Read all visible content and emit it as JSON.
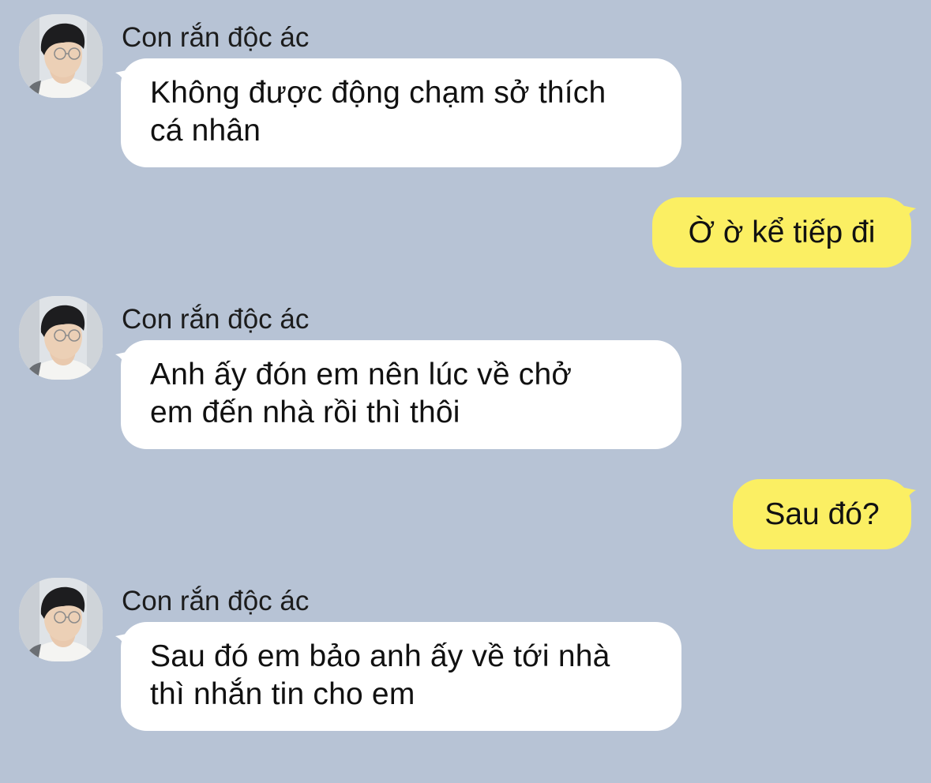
{
  "chat": {
    "messages": [
      {
        "direction": "incoming",
        "sender": "Con rắn độc ác",
        "text_line1": "Không được động chạm sở thích",
        "text_line2": "cá nhân"
      },
      {
        "direction": "outgoing",
        "text": "Ờ ờ kể tiếp đi"
      },
      {
        "direction": "incoming",
        "sender": "Con rắn độc ác",
        "text_line1": "Anh ấy đón em nên lúc về chở",
        "text_line2": "em đến nhà rồi thì thôi"
      },
      {
        "direction": "outgoing",
        "text": "Sau đó?"
      },
      {
        "direction": "incoming",
        "sender": "Con rắn độc ác",
        "text_line1": "Sau đó em bảo anh ấy về tới nhà",
        "text_line2": "thì nhắn tin cho em"
      }
    ]
  },
  "colors": {
    "background": "#b7c3d5",
    "incoming_bubble": "#ffffff",
    "outgoing_bubble": "#fbef63"
  },
  "icons": {
    "avatar": "avatar-photo"
  }
}
